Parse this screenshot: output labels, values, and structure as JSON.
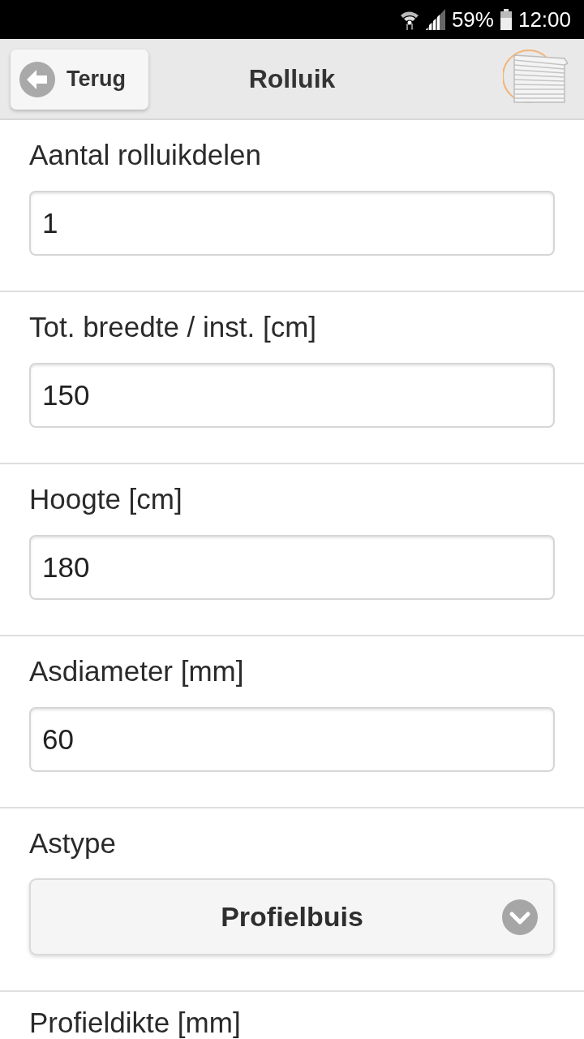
{
  "status_bar": {
    "battery": "59%",
    "time": "12:00"
  },
  "header": {
    "back_button": "Terug",
    "title": "Rolluik"
  },
  "fields": [
    {
      "kind": "input",
      "label": "Aantal rolluikdelen",
      "value": "1"
    },
    {
      "kind": "input",
      "label": "Tot. breedte / inst. [cm]",
      "value": "150"
    },
    {
      "kind": "input",
      "label": "Hoogte [cm]",
      "value": "180"
    },
    {
      "kind": "input",
      "label": "Asdiameter [mm]",
      "value": "60"
    },
    {
      "kind": "select",
      "label": "Astype",
      "value": "Profielbuis"
    },
    {
      "label": "Profieldikte [mm]"
    }
  ]
}
